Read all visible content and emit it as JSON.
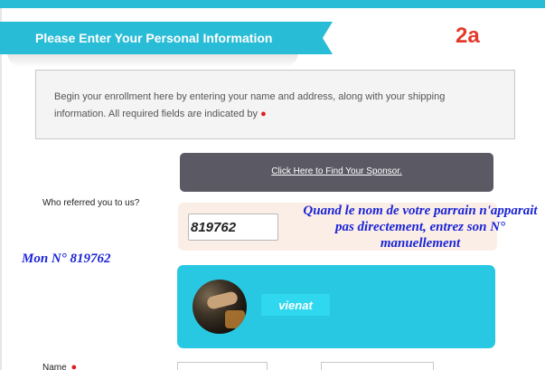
{
  "header": {
    "section_title": "Please Enter Your Personal Information",
    "step_label": "2a"
  },
  "info": {
    "text": "Begin your enrollment here by entering your name and address, along with your shipping information. All required fields are indicated by",
    "required_marker": "●"
  },
  "sponsor": {
    "find_link": "Click Here to Find Your Sponsor.",
    "referred_label": "Who referred you to us?",
    "id_value": "819762",
    "name": "vienat"
  },
  "annotations": {
    "note": "Quand le nom de votre parrain n'apparait pas directement, entrez son N° manuellement",
    "my_number": "Mon N°  819762"
  },
  "form": {
    "name_label": "Name",
    "required_marker": "●"
  },
  "colors": {
    "accent": "#29bcd6",
    "card": "#29c8e2",
    "step_red": "#e43a2a",
    "annotation_blue": "#1b24d6",
    "button_dark": "#5b5a64"
  }
}
